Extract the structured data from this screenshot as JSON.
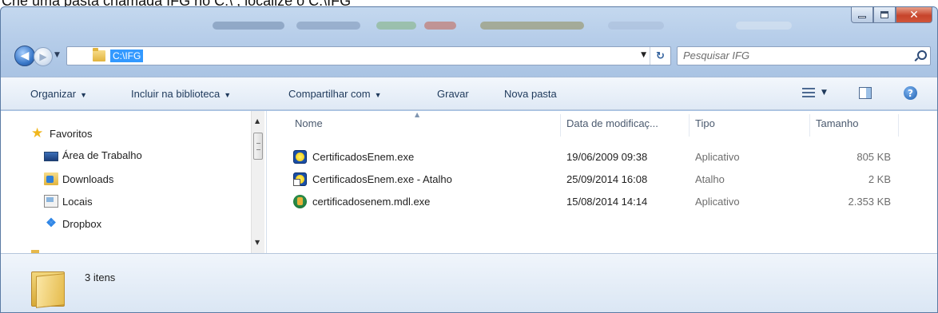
{
  "caption": {
    "text": "Crie uma pasta chamada IFG no C:\\ , localize o C:\\IFG"
  },
  "window": {
    "buttons": {
      "minimize": "minimize",
      "maximize": "maximize",
      "close": "x"
    }
  },
  "nav": {
    "address_path": "C:\\IFG",
    "search_placeholder": "Pesquisar IFG"
  },
  "toolbar": {
    "organize": "Organizar",
    "include_library": "Incluir na biblioteca",
    "share_with": "Compartilhar com",
    "burn": "Gravar",
    "new_folder": "Nova pasta",
    "help": "?"
  },
  "sidebar": {
    "items": [
      {
        "label": "Favoritos",
        "icon": "star-icon"
      },
      {
        "label": "Área de Trabalho",
        "icon": "desktop-icon"
      },
      {
        "label": "Downloads",
        "icon": "downloads-icon"
      },
      {
        "label": "Locais",
        "icon": "recent-places-icon"
      },
      {
        "label": "Dropbox",
        "icon": "dropbox-icon"
      }
    ]
  },
  "columns": {
    "name": "Nome",
    "modified": "Data de modificaç...",
    "type": "Tipo",
    "size": "Tamanho"
  },
  "files": [
    {
      "name": "CertificadosEnem.exe",
      "modified": "19/06/2009 09:38",
      "type": "Aplicativo",
      "size": "805 KB",
      "icon": "application-icon"
    },
    {
      "name": "CertificadosEnem.exe - Atalho",
      "modified": "25/09/2014 16:08",
      "type": "Atalho",
      "size": "2 KB",
      "icon": "shortcut-icon"
    },
    {
      "name": "certificadosenem.mdl.exe",
      "modified": "15/08/2014 14:14",
      "type": "Aplicativo",
      "size": "2.353 KB",
      "icon": "installer-icon"
    }
  ],
  "status": {
    "item_count": "3 itens"
  }
}
